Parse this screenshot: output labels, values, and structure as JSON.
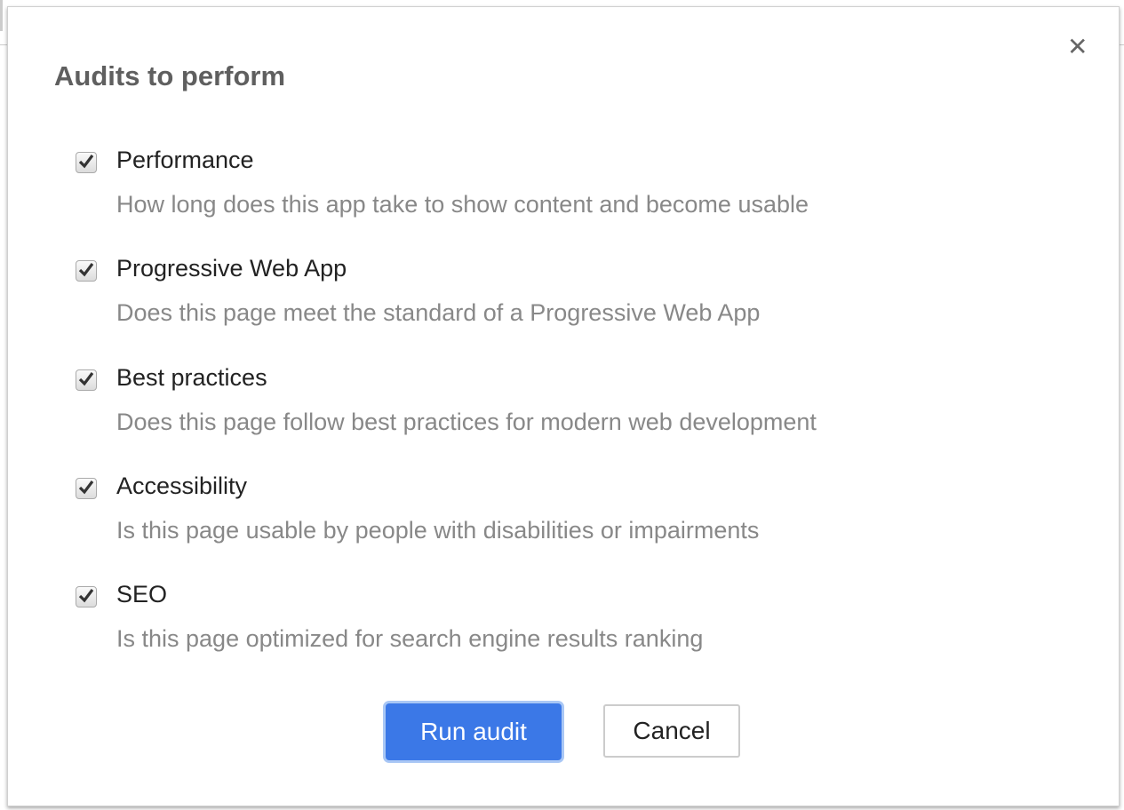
{
  "dialog": {
    "title": "Audits to perform",
    "close_icon": "close-icon",
    "audits": [
      {
        "label": "Performance",
        "description": "How long does this app take to show content and become usable",
        "checked": true
      },
      {
        "label": "Progressive Web App",
        "description": "Does this page meet the standard of a Progressive Web App",
        "checked": true
      },
      {
        "label": "Best practices",
        "description": "Does this page follow best practices for modern web development",
        "checked": true
      },
      {
        "label": "Accessibility",
        "description": "Is this page usable by people with disabilities or impairments",
        "checked": true
      },
      {
        "label": "SEO",
        "description": "Is this page optimized for search engine results ranking",
        "checked": true
      }
    ],
    "run_label": "Run audit",
    "cancel_label": "Cancel",
    "accent_color": "#3b78e7"
  }
}
